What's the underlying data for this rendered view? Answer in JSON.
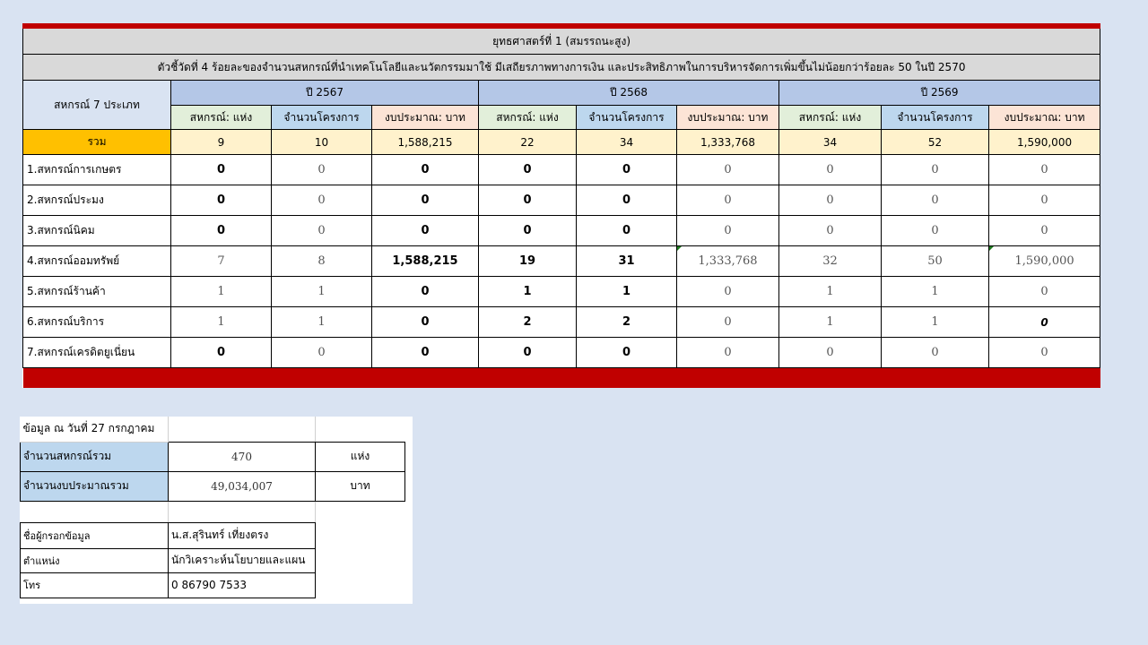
{
  "title": "ยุทธศาสตร์ที่ 1 (สมรรถนะสูง)",
  "subtitle": "ตัวชี้วัดที่ 4 ร้อยละของจำนวนสหกรณ์ที่นำเทคโนโลยีและนวัตกรรมมาใช้ มีเสถียรภาพทางการเงิน และประสิทธิภาพในการบริหารจัดการเพิ่มขึ้นไม่น้อยกว่าร้อยละ 50 ในปี 2570",
  "category_header": "สหกรณ์ 7 ประเภท",
  "years": [
    "ปี 2567",
    "ปี 2568",
    "ปี 2569"
  ],
  "column_headers": [
    "สหกรณ์: แห่ง",
    "จำนวนโครงการ",
    "งบประมาณ: บาท"
  ],
  "total_row": {
    "label": "รวม",
    "values": [
      "9",
      "10",
      "1,588,215",
      "22",
      "34",
      "1,333,768",
      "34",
      "52",
      "1,590,000"
    ]
  },
  "rows": [
    {
      "label": "1.สหกรณ์การเกษตร",
      "values": [
        "0",
        "0",
        "0",
        "0",
        "0",
        "0",
        "0",
        "0",
        "0"
      ]
    },
    {
      "label": "2.สหกรณ์ประมง",
      "values": [
        "0",
        "0",
        "0",
        "0",
        "0",
        "0",
        "0",
        "0",
        "0"
      ]
    },
    {
      "label": "3.สหกรณ์นิคม",
      "values": [
        "0",
        "0",
        "0",
        "0",
        "0",
        "0",
        "0",
        "0",
        "0"
      ]
    },
    {
      "label": "4.สหกรณ์ออมทรัพย์",
      "values": [
        "7",
        "8",
        "1,588,215",
        "19",
        "31",
        "1,333,768",
        "32",
        "50",
        "1,590,000"
      ]
    },
    {
      "label": "5.สหกรณ์ร้านค้า",
      "values": [
        "1",
        "1",
        "0",
        "1",
        "1",
        "0",
        "1",
        "1",
        "0"
      ]
    },
    {
      "label": "6.สหกรณ์บริการ",
      "values": [
        "1",
        "1",
        "0",
        "2",
        "2",
        "0",
        "1",
        "1",
        "0"
      ]
    },
    {
      "label": "7.สหกรณ์เครดิตยูเนี่ยน",
      "values": [
        "0",
        "0",
        "0",
        "0",
        "0",
        "0",
        "0",
        "0",
        "0"
      ]
    }
  ],
  "summary": {
    "date_label": "ข้อมูล ณ วันที่  27 กรกฎาคม",
    "coops_label": "จำนวนสหกรณ์รวม",
    "coops_value": "470",
    "coops_unit": "แห่ง",
    "budget_label": "จำนวนงบประมาณรวม",
    "budget_value": "49,034,007",
    "budget_unit": "บาท"
  },
  "contact": {
    "name_label": "ชื่อผู้กรอกข้อมูล",
    "name_value": "น.ส.สุรินทร์ เที่ยงตรง",
    "position_label": "ตำแหน่ง",
    "position_value": "นักวิเคราะห์นโยบายและแผน",
    "phone_label": "โทร",
    "phone_value": "0 86790 7533"
  },
  "colors": {
    "accent_red": "#c00000",
    "total_orange": "#ffc000",
    "year_blue": "#b4c7e7",
    "background": "#d9e3f2"
  }
}
